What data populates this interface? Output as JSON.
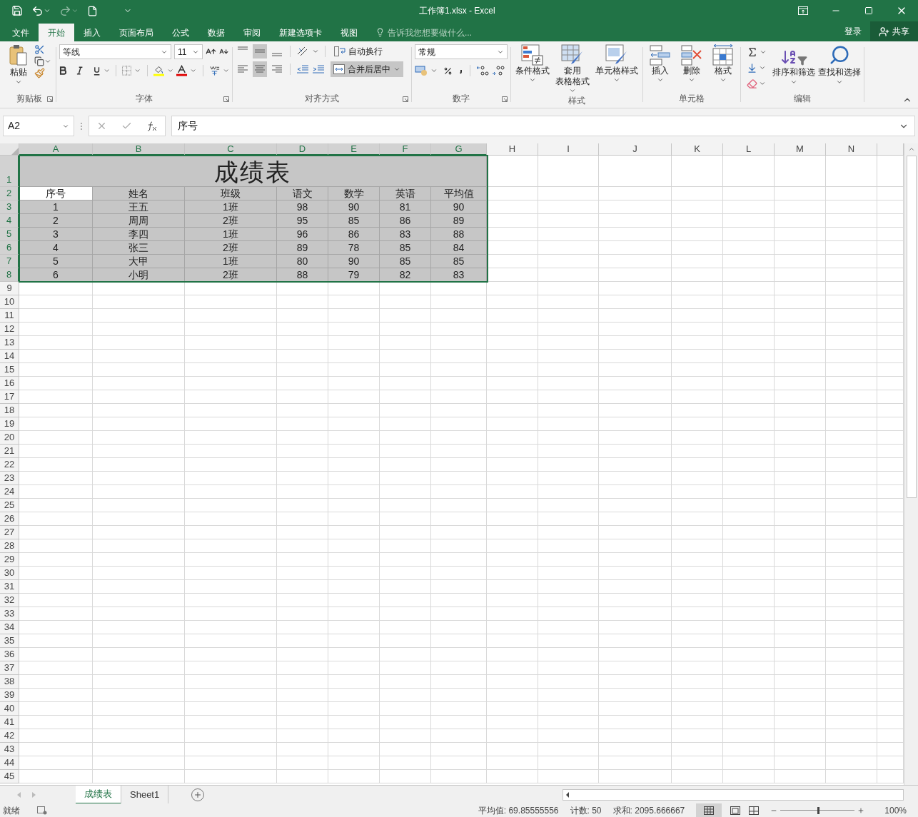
{
  "window": {
    "title": "工作簿1.xlsx - Excel"
  },
  "menu_tabs": [
    {
      "label": "文件",
      "selected": false
    },
    {
      "label": "开始",
      "selected": true
    },
    {
      "label": "插入",
      "selected": false
    },
    {
      "label": "页面布局",
      "selected": false
    },
    {
      "label": "公式",
      "selected": false
    },
    {
      "label": "数据",
      "selected": false
    },
    {
      "label": "审阅",
      "selected": false
    },
    {
      "label": "新建选项卡",
      "selected": false
    },
    {
      "label": "视图",
      "selected": false
    }
  ],
  "tell_me": {
    "placeholder": "告诉我您想要做什么..."
  },
  "account": {
    "sign_in": "登录",
    "share": "共享"
  },
  "ribbon": {
    "clipboard": {
      "label": "剪贴板",
      "paste": "粘贴"
    },
    "font": {
      "label": "字体",
      "font_name": "等线",
      "font_size": "11"
    },
    "alignment": {
      "label": "对齐方式",
      "wrap_text": "自动换行",
      "merge": "合并后居中",
      "merge_on": true,
      "center_on": true
    },
    "number": {
      "label": "数字",
      "format": "常规"
    },
    "styles": {
      "label": "样式",
      "buttons": [
        {
          "kind": "conditional",
          "label": "条件格式"
        },
        {
          "kind": "table",
          "label": [
            "套用",
            "表格格式"
          ]
        },
        {
          "kind": "cellstyle",
          "label": "单元格样式"
        }
      ]
    },
    "cells": {
      "label": "单元格",
      "buttons": [
        {
          "kind": "insert",
          "label": "插入"
        },
        {
          "kind": "delete",
          "label": "删除"
        },
        {
          "kind": "format",
          "label": "格式"
        }
      ]
    },
    "editing": {
      "label": "编辑",
      "buttons": [
        {
          "kind": "sort",
          "label": "排序和筛选"
        },
        {
          "kind": "find",
          "label": "查找和选择"
        }
      ]
    }
  },
  "formula_bar": {
    "name_box": "A2",
    "value": "序号"
  },
  "sheet": {
    "columns": [
      {
        "label": "A",
        "selected": true
      },
      {
        "label": "B",
        "selected": true
      },
      {
        "label": "C",
        "selected": true
      },
      {
        "label": "D",
        "selected": true
      },
      {
        "label": "E",
        "selected": true
      },
      {
        "label": "F",
        "selected": true
      },
      {
        "label": "G",
        "selected": true
      },
      {
        "label": "H",
        "selected": false
      },
      {
        "label": "I",
        "selected": false
      },
      {
        "label": "J",
        "selected": false
      },
      {
        "label": "K",
        "selected": false
      },
      {
        "label": "L",
        "selected": false
      },
      {
        "label": "M",
        "selected": false
      },
      {
        "label": "N",
        "selected": false
      }
    ],
    "title_row": {
      "number": "1",
      "selected": true,
      "text": "成绩表"
    },
    "rows": [
      {
        "number": "2",
        "selected": true,
        "cells": [
          {
            "text": "序号",
            "active": true
          },
          {
            "text": "姓名",
            "active": false
          },
          {
            "text": "班级",
            "active": false
          },
          {
            "text": "语文",
            "active": false
          },
          {
            "text": "数学",
            "active": false
          },
          {
            "text": "英语",
            "active": false
          },
          {
            "text": "平均值",
            "active": false
          }
        ]
      },
      {
        "number": "3",
        "selected": true,
        "cells": [
          {
            "text": "1",
            "active": false
          },
          {
            "text": "王五",
            "active": false
          },
          {
            "text": "1班",
            "active": false
          },
          {
            "text": "98",
            "active": false
          },
          {
            "text": "90",
            "active": false
          },
          {
            "text": "81",
            "active": false
          },
          {
            "text": "90",
            "active": false
          }
        ]
      },
      {
        "number": "4",
        "selected": true,
        "cells": [
          {
            "text": "2",
            "active": false
          },
          {
            "text": "周周",
            "active": false
          },
          {
            "text": "2班",
            "active": false
          },
          {
            "text": "95",
            "active": false
          },
          {
            "text": "85",
            "active": false
          },
          {
            "text": "86",
            "active": false
          },
          {
            "text": "89",
            "active": false
          }
        ]
      },
      {
        "number": "5",
        "selected": true,
        "cells": [
          {
            "text": "3",
            "active": false
          },
          {
            "text": "李四",
            "active": false
          },
          {
            "text": "1班",
            "active": false
          },
          {
            "text": "96",
            "active": false
          },
          {
            "text": "86",
            "active": false
          },
          {
            "text": "83",
            "active": false
          },
          {
            "text": "88",
            "active": false
          }
        ]
      },
      {
        "number": "6",
        "selected": true,
        "cells": [
          {
            "text": "4",
            "active": false
          },
          {
            "text": "张三",
            "active": false
          },
          {
            "text": "2班",
            "active": false
          },
          {
            "text": "89",
            "active": false
          },
          {
            "text": "78",
            "active": false
          },
          {
            "text": "85",
            "active": false
          },
          {
            "text": "84",
            "active": false
          }
        ]
      },
      {
        "number": "7",
        "selected": true,
        "cells": [
          {
            "text": "5",
            "active": false
          },
          {
            "text": "大甲",
            "active": false
          },
          {
            "text": "1班",
            "active": false
          },
          {
            "text": "80",
            "active": false
          },
          {
            "text": "90",
            "active": false
          },
          {
            "text": "85",
            "active": false
          },
          {
            "text": "85",
            "active": false
          }
        ]
      },
      {
        "number": "8",
        "selected": true,
        "cells": [
          {
            "text": "6",
            "active": false
          },
          {
            "text": "小明",
            "active": false
          },
          {
            "text": "2班",
            "active": false
          },
          {
            "text": "88",
            "active": false
          },
          {
            "text": "79",
            "active": false
          },
          {
            "text": "82",
            "active": false
          },
          {
            "text": "83",
            "active": false
          }
        ]
      },
      {
        "number": "9",
        "selected": false,
        "cells": []
      },
      {
        "number": "10",
        "selected": false,
        "cells": []
      },
      {
        "number": "11",
        "selected": false,
        "cells": []
      },
      {
        "number": "12",
        "selected": false,
        "cells": []
      },
      {
        "number": "13",
        "selected": false,
        "cells": []
      },
      {
        "number": "14",
        "selected": false,
        "cells": []
      },
      {
        "number": "15",
        "selected": false,
        "cells": []
      },
      {
        "number": "16",
        "selected": false,
        "cells": []
      },
      {
        "number": "17",
        "selected": false,
        "cells": []
      },
      {
        "number": "18",
        "selected": false,
        "cells": []
      },
      {
        "number": "19",
        "selected": false,
        "cells": []
      },
      {
        "number": "20",
        "selected": false,
        "cells": []
      },
      {
        "number": "21",
        "selected": false,
        "cells": []
      },
      {
        "number": "22",
        "selected": false,
        "cells": []
      },
      {
        "number": "23",
        "selected": false,
        "cells": []
      },
      {
        "number": "24",
        "selected": false,
        "cells": []
      },
      {
        "number": "25",
        "selected": false,
        "cells": []
      },
      {
        "number": "26",
        "selected": false,
        "cells": []
      },
      {
        "number": "27",
        "selected": false,
        "cells": []
      },
      {
        "number": "28",
        "selected": false,
        "cells": []
      },
      {
        "number": "29",
        "selected": false,
        "cells": []
      },
      {
        "number": "30",
        "selected": false,
        "cells": []
      },
      {
        "number": "31",
        "selected": false,
        "cells": []
      },
      {
        "number": "32",
        "selected": false,
        "cells": []
      },
      {
        "number": "33",
        "selected": false,
        "cells": []
      },
      {
        "number": "34",
        "selected": false,
        "cells": []
      },
      {
        "number": "35",
        "selected": false,
        "cells": []
      },
      {
        "number": "36",
        "selected": false,
        "cells": []
      },
      {
        "number": "37",
        "selected": false,
        "cells": []
      },
      {
        "number": "38",
        "selected": false,
        "cells": []
      },
      {
        "number": "39",
        "selected": false,
        "cells": []
      },
      {
        "number": "40",
        "selected": false,
        "cells": []
      },
      {
        "number": "41",
        "selected": false,
        "cells": []
      },
      {
        "number": "42",
        "selected": false,
        "cells": []
      },
      {
        "number": "43",
        "selected": false,
        "cells": []
      },
      {
        "number": "44",
        "selected": false,
        "cells": []
      },
      {
        "number": "45",
        "selected": false,
        "cells": []
      }
    ]
  },
  "sheet_tabs": [
    {
      "label": "成绩表",
      "selected": true
    },
    {
      "label": "Sheet1",
      "selected": false
    }
  ],
  "status_bar": {
    "ready": "就绪",
    "average": "平均值: 69.85555556",
    "count": "计数: 50",
    "sum": "求和: 2095.666667",
    "zoom": "100%",
    "zoom_slider": {
      "level": 0.5
    }
  }
}
